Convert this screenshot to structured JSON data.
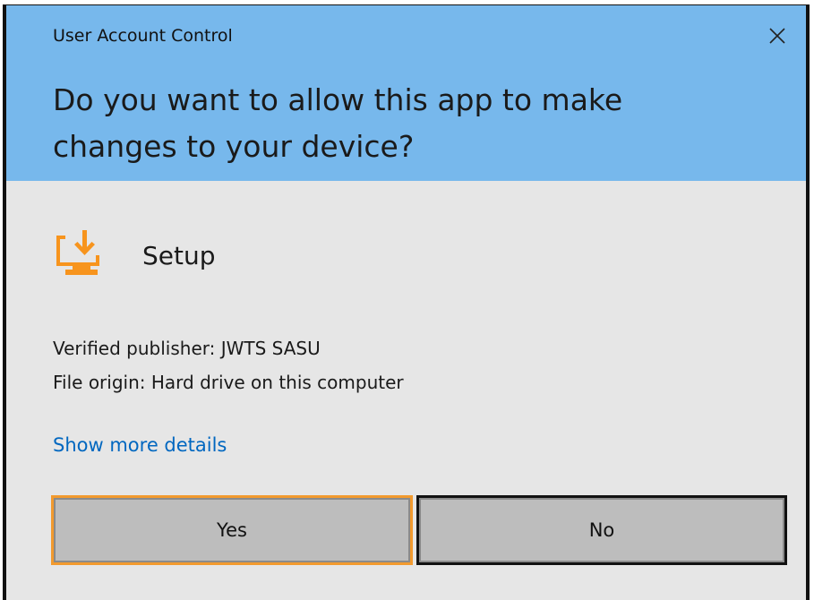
{
  "dialog": {
    "window_title": "User Account Control",
    "question": "Do you want to allow this app to make changes to your device?",
    "app_name": "Setup",
    "app_icon": "monitor-download-icon",
    "publisher_line": "Verified publisher: JWTS SASU",
    "origin_line": "File origin: Hard drive on this computer",
    "details_link": "Show more details",
    "yes_label": "Yes",
    "no_label": "No"
  },
  "colors": {
    "header_bg": "#77b8ec",
    "body_bg": "#e6e6e6",
    "link": "#0067c0",
    "icon_accent": "#f7941d",
    "focus_border": "#f29a2e",
    "button_bg": "#bdbdbd"
  }
}
